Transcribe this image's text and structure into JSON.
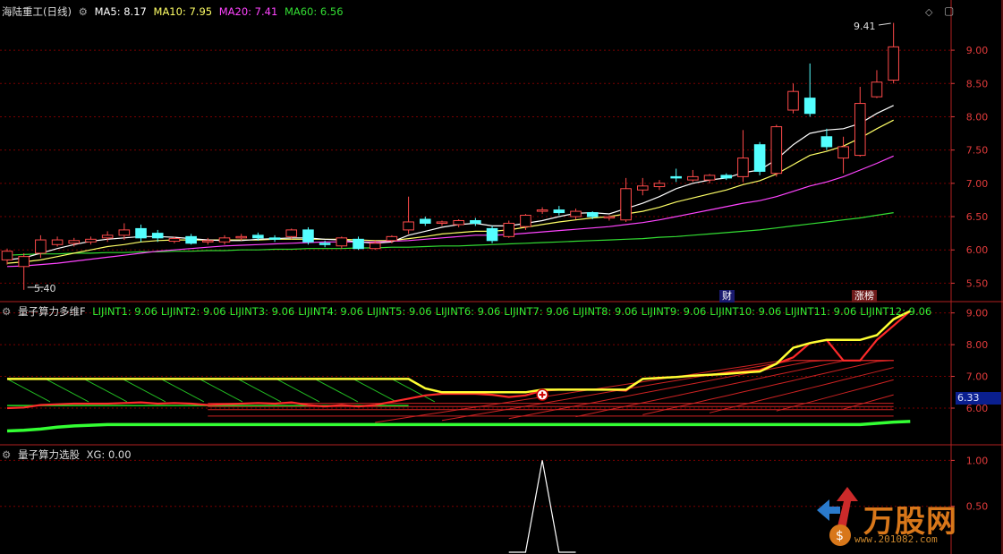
{
  "colors": {
    "up": "#ff4a4a",
    "down": "#54ffff",
    "ma5": "#ffffff",
    "ma10": "#ffff66",
    "ma20": "#ff44ff",
    "ma60": "#33dd33",
    "grid": "#7a0000",
    "axis": "#e23b3b"
  },
  "panel1": {
    "title": "海陆重工(日线)",
    "ma_labels": [
      "MA5: 8.17",
      "MA10: 7.95",
      "MA20: 7.41",
      "MA60: 6.56"
    ],
    "max_label": "9.41",
    "min_label": "5.40",
    "badge_fin": "财",
    "badge_list": "涨榜"
  },
  "panel2": {
    "title": "量子算力多维F",
    "labels": [
      "LIJINT1: 9.06",
      "LIJINT2: 9.06",
      "LIJINT3: 9.06",
      "LIJINT4: 9.06",
      "LIJINT5: 9.06",
      "LIJINT6: 9.06",
      "LIJINT7: 9.06",
      "LIJINT8: 9.06",
      "LIJINT9: 9.06",
      "LIJINT10: 9.06",
      "LIJINT11: 9.06",
      "LIJINT12: 9.06"
    ],
    "current_value": "6.33"
  },
  "panel3": {
    "title": "量子算力选股",
    "xg_label": "XG: 0.00"
  },
  "watermark": {
    "brand": "万股网",
    "url": "www.201082.com"
  },
  "chart_data": [
    {
      "type": "candlestick",
      "title": "海陆重工(日线)",
      "yticks": [
        5.5,
        6.0,
        6.5,
        7.0,
        7.5,
        8.0,
        8.5,
        9.0
      ],
      "ylim": [
        5.25,
        9.7
      ],
      "candles": [
        [
          5.85,
          5.98,
          5.78,
          6.02
        ],
        [
          5.75,
          5.9,
          5.4,
          5.95
        ],
        [
          5.95,
          6.15,
          5.88,
          6.22
        ],
        [
          6.08,
          6.15,
          6.05,
          6.2
        ],
        [
          6.1,
          6.14,
          6.05,
          6.18
        ],
        [
          6.12,
          6.16,
          6.08,
          6.2
        ],
        [
          6.18,
          6.22,
          6.12,
          6.28
        ],
        [
          6.22,
          6.3,
          6.15,
          6.4
        ],
        [
          6.32,
          6.18,
          6.12,
          6.38
        ],
        [
          6.25,
          6.18,
          6.12,
          6.3
        ],
        [
          6.13,
          6.17,
          6.1,
          6.2
        ],
        [
          6.2,
          6.1,
          6.08,
          6.24
        ],
        [
          6.12,
          6.14,
          6.08,
          6.18
        ],
        [
          6.12,
          6.18,
          6.08,
          6.22
        ],
        [
          6.18,
          6.2,
          6.14,
          6.24
        ],
        [
          6.22,
          6.18,
          6.14,
          6.26
        ],
        [
          6.18,
          6.16,
          6.12,
          6.22
        ],
        [
          6.2,
          6.3,
          6.16,
          6.32
        ],
        [
          6.3,
          6.12,
          6.08,
          6.34
        ],
        [
          6.1,
          6.08,
          6.04,
          6.14
        ],
        [
          6.06,
          6.18,
          6.02,
          6.2
        ],
        [
          6.16,
          6.02,
          6.0,
          6.2
        ],
        [
          6.02,
          6.1,
          6.0,
          6.14
        ],
        [
          6.14,
          6.2,
          6.1,
          6.22
        ],
        [
          6.3,
          6.42,
          6.24,
          6.8
        ],
        [
          6.46,
          6.4,
          6.36,
          6.5
        ],
        [
          6.4,
          6.42,
          6.36,
          6.44
        ],
        [
          6.38,
          6.44,
          6.34,
          6.46
        ],
        [
          6.44,
          6.4,
          6.36,
          6.48
        ],
        [
          6.32,
          6.14,
          6.1,
          6.36
        ],
        [
          6.2,
          6.4,
          6.18,
          6.44
        ],
        [
          6.35,
          6.52,
          6.3,
          6.54
        ],
        [
          6.58,
          6.6,
          6.54,
          6.64
        ],
        [
          6.6,
          6.56,
          6.52,
          6.66
        ],
        [
          6.5,
          6.58,
          6.46,
          6.62
        ],
        [
          6.56,
          6.5,
          6.46,
          6.58
        ],
        [
          6.48,
          6.5,
          6.44,
          6.52
        ],
        [
          6.45,
          6.92,
          6.42,
          7.08
        ],
        [
          6.9,
          6.96,
          6.82,
          7.08
        ],
        [
          6.95,
          7.0,
          6.9,
          7.05
        ],
        [
          7.1,
          7.08,
          7.02,
          7.22
        ],
        [
          7.05,
          7.1,
          7.02,
          7.2
        ],
        [
          7.05,
          7.12,
          7.0,
          7.14
        ],
        [
          7.12,
          7.08,
          7.05,
          7.15
        ],
        [
          7.1,
          7.38,
          7.02,
          7.8
        ],
        [
          7.58,
          7.18,
          7.12,
          7.62
        ],
        [
          7.15,
          7.85,
          7.1,
          7.88
        ],
        [
          8.1,
          8.38,
          8.05,
          8.5
        ],
        [
          8.28,
          8.05,
          8.0,
          8.8
        ],
        [
          7.7,
          7.55,
          7.5,
          7.82
        ],
        [
          7.38,
          7.55,
          7.15,
          7.7
        ],
        [
          7.42,
          8.2,
          7.4,
          8.45
        ],
        [
          8.3,
          8.52,
          8.28,
          8.7
        ],
        [
          8.55,
          9.05,
          8.5,
          9.41
        ]
      ],
      "ma5": [
        5.85,
        5.88,
        5.95,
        6.02,
        6.08,
        6.13,
        6.16,
        6.18,
        6.2,
        6.2,
        6.19,
        6.17,
        6.15,
        6.14,
        6.14,
        6.16,
        6.17,
        6.18,
        6.18,
        6.16,
        6.15,
        6.12,
        6.1,
        6.12,
        6.22,
        6.28,
        6.34,
        6.38,
        6.4,
        6.36,
        6.36,
        6.4,
        6.44,
        6.5,
        6.55,
        6.56,
        6.54,
        6.62,
        6.7,
        6.8,
        6.92,
        7.0,
        7.05,
        7.08,
        7.16,
        7.2,
        7.36,
        7.58,
        7.75,
        7.8,
        7.82,
        7.9,
        8.05,
        8.17
      ],
      "ma10": [
        5.8,
        5.82,
        5.85,
        5.9,
        5.95,
        6.0,
        6.05,
        6.08,
        6.12,
        6.14,
        6.15,
        6.15,
        6.15,
        6.15,
        6.15,
        6.15,
        6.16,
        6.16,
        6.16,
        6.16,
        6.16,
        6.15,
        6.14,
        6.14,
        6.17,
        6.2,
        6.24,
        6.26,
        6.28,
        6.28,
        6.3,
        6.34,
        6.38,
        6.42,
        6.45,
        6.48,
        6.5,
        6.54,
        6.58,
        6.64,
        6.72,
        6.78,
        6.84,
        6.9,
        6.98,
        7.04,
        7.14,
        7.28,
        7.42,
        7.48,
        7.56,
        7.68,
        7.82,
        7.95
      ],
      "ma20": [
        5.75,
        5.76,
        5.78,
        5.8,
        5.83,
        5.86,
        5.89,
        5.92,
        5.95,
        5.98,
        6.0,
        6.02,
        6.04,
        6.06,
        6.07,
        6.08,
        6.09,
        6.1,
        6.11,
        6.12,
        6.12,
        6.12,
        6.12,
        6.13,
        6.14,
        6.16,
        6.18,
        6.2,
        6.22,
        6.22,
        6.23,
        6.25,
        6.27,
        6.29,
        6.31,
        6.33,
        6.35,
        6.38,
        6.41,
        6.45,
        6.5,
        6.55,
        6.6,
        6.65,
        6.7,
        6.74,
        6.8,
        6.88,
        6.96,
        7.02,
        7.1,
        7.2,
        7.3,
        7.41
      ],
      "ma60": [
        5.92,
        5.93,
        5.94,
        5.94,
        5.95,
        5.95,
        5.96,
        5.96,
        5.97,
        5.97,
        5.98,
        5.98,
        5.99,
        5.99,
        6.0,
        6.0,
        6.01,
        6.01,
        6.02,
        6.02,
        6.02,
        6.03,
        6.03,
        6.04,
        6.04,
        6.05,
        6.06,
        6.06,
        6.07,
        6.08,
        6.09,
        6.1,
        6.11,
        6.12,
        6.13,
        6.14,
        6.15,
        6.16,
        6.17,
        6.19,
        6.2,
        6.22,
        6.24,
        6.26,
        6.28,
        6.3,
        6.33,
        6.36,
        6.39,
        6.42,
        6.45,
        6.48,
        6.52,
        6.56
      ]
    },
    {
      "type": "line",
      "title": "量子算力多维F",
      "yticks": [
        6.0,
        7.0,
        8.0,
        9.0
      ],
      "ylim": [
        4.9,
        9.3
      ],
      "yellow": [
        6.92,
        6.92,
        6.92,
        6.92,
        6.92,
        6.92,
        6.92,
        6.92,
        6.92,
        6.92,
        6.92,
        6.92,
        6.92,
        6.92,
        6.92,
        6.92,
        6.92,
        6.92,
        6.92,
        6.92,
        6.92,
        6.92,
        6.92,
        6.92,
        6.92,
        6.62,
        6.5,
        6.5,
        6.5,
        6.5,
        6.5,
        6.5,
        6.58,
        6.58,
        6.58,
        6.58,
        6.58,
        6.58,
        6.92,
        6.95,
        6.98,
        7.02,
        7.05,
        7.08,
        7.12,
        7.15,
        7.4,
        7.9,
        8.05,
        8.15,
        8.15,
        8.15,
        8.3,
        8.8,
        9.06
      ],
      "red": [
        6.0,
        6.02,
        6.1,
        6.12,
        6.14,
        6.14,
        6.14,
        6.16,
        6.18,
        6.14,
        6.16,
        6.14,
        6.1,
        6.12,
        6.14,
        6.16,
        6.14,
        6.18,
        6.1,
        6.05,
        6.1,
        6.05,
        6.1,
        6.2,
        6.3,
        6.4,
        6.45,
        6.45,
        6.45,
        6.42,
        6.35,
        6.4,
        6.55,
        6.58,
        6.58,
        6.58,
        6.58,
        6.55,
        6.92,
        6.95,
        6.98,
        7.02,
        7.05,
        7.1,
        7.15,
        7.2,
        7.4,
        7.6,
        8.05,
        8.15,
        7.5,
        7.5,
        8.15,
        8.6,
        9.06
      ],
      "green_top": [
        6.92,
        6.92,
        6.92,
        6.92,
        6.92,
        6.92,
        6.92,
        6.92,
        6.92,
        6.92,
        6.92,
        6.92,
        6.92,
        6.92,
        6.92,
        6.92,
        6.92,
        6.92,
        6.92,
        6.92,
        6.92,
        6.92,
        6.92,
        6.92,
        6.92
      ],
      "green_low": [
        5.28,
        5.3,
        5.34,
        5.4,
        5.44,
        5.46,
        5.48,
        5.48,
        5.48,
        5.48,
        5.48,
        5.48,
        5.48,
        5.48,
        5.48,
        5.48,
        5.48,
        5.48,
        5.48,
        5.48,
        5.48,
        5.48,
        5.48,
        5.48,
        5.48,
        5.48,
        5.48,
        5.48,
        5.48,
        5.48,
        5.48,
        5.48,
        5.48,
        5.48,
        5.48,
        5.48,
        5.48,
        5.48,
        5.48,
        5.48,
        5.48,
        5.48,
        5.48,
        5.48,
        5.48,
        5.48,
        5.48,
        5.48,
        5.48,
        5.48,
        5.48,
        5.48,
        5.52,
        5.56,
        5.58
      ],
      "current": 6.33
    },
    {
      "type": "line",
      "title": "量子算力选股",
      "yticks": [
        0.5,
        1.0
      ],
      "ylim": [
        0,
        1.15
      ],
      "xg": [
        0,
        0,
        0,
        0,
        0,
        0,
        0,
        0,
        0,
        0,
        0,
        0,
        0,
        0,
        0,
        0,
        0,
        0,
        0,
        0,
        0,
        0,
        0,
        0,
        0,
        0,
        0,
        0,
        0,
        0,
        0,
        0,
        1,
        0,
        0,
        0,
        0,
        0,
        0,
        0,
        0,
        0,
        0,
        0,
        0,
        0,
        0,
        0,
        0,
        0,
        0,
        0,
        0,
        0,
        0
      ]
    }
  ]
}
